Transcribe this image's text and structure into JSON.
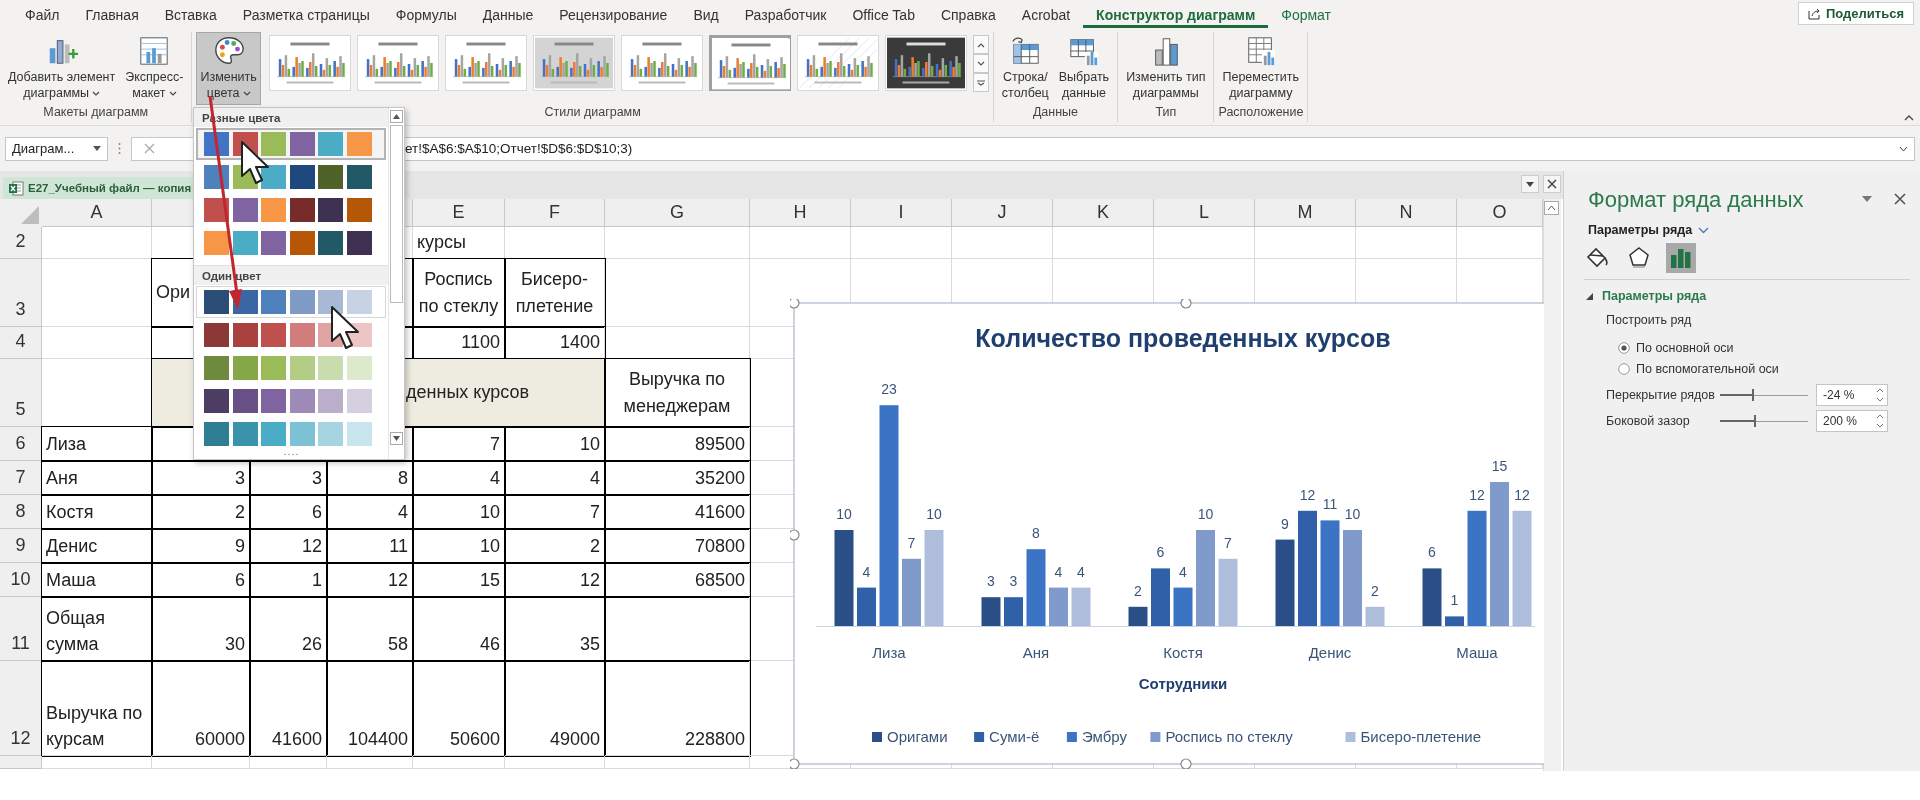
{
  "tabs": [
    {
      "label": "Файл",
      "selected": false,
      "contextual": false
    },
    {
      "label": "Главная",
      "selected": false,
      "contextual": false
    },
    {
      "label": "Вставка",
      "selected": false,
      "contextual": false
    },
    {
      "label": "Разметка страницы",
      "selected": false,
      "contextual": false
    },
    {
      "label": "Формулы",
      "selected": false,
      "contextual": false
    },
    {
      "label": "Данные",
      "selected": false,
      "contextual": false
    },
    {
      "label": "Рецензирование",
      "selected": false,
      "contextual": false
    },
    {
      "label": "Вид",
      "selected": false,
      "contextual": false
    },
    {
      "label": "Разработчик",
      "selected": false,
      "contextual": false
    },
    {
      "label": "Office Tab",
      "selected": false,
      "contextual": false
    },
    {
      "label": "Справка",
      "selected": false,
      "contextual": false
    },
    {
      "label": "Acrobat",
      "selected": false,
      "contextual": false
    },
    {
      "label": "Конструктор диаграмм",
      "selected": true,
      "contextual": true
    },
    {
      "label": "Формат",
      "selected": false,
      "contextual": true
    }
  ],
  "share_button": {
    "label": "Поделиться"
  },
  "ribbon": {
    "groups": [
      {
        "label": "Макеты диаграмм",
        "buttons": [
          {
            "kind": "add-element",
            "label": "Добавить элемент\nдиаграммы",
            "dropdown": true,
            "pressed": false
          },
          {
            "kind": "quick-layout",
            "label": "Экспресс-\nмакет",
            "dropdown": true,
            "pressed": false
          }
        ]
      },
      {
        "label": "Стили диаграмм",
        "buttons": [
          {
            "kind": "colors",
            "label": "Изменить\nцвета",
            "dropdown": true,
            "pressed": true
          }
        ],
        "styles": [
          {
            "kind": "light",
            "selected": false
          },
          {
            "kind": "light",
            "selected": false
          },
          {
            "kind": "light",
            "selected": false
          },
          {
            "kind": "gray",
            "selected": false
          },
          {
            "kind": "light",
            "selected": false
          },
          {
            "kind": "light",
            "selected": true
          },
          {
            "kind": "hatched",
            "selected": false
          },
          {
            "kind": "dark",
            "selected": false
          }
        ]
      },
      {
        "label": "Данные",
        "buttons": [
          {
            "kind": "switch",
            "label": "Строка/\nстолбец",
            "dropdown": false,
            "pressed": false
          },
          {
            "kind": "select-data",
            "label": "Выбрать\nданные",
            "dropdown": false,
            "pressed": false
          }
        ]
      },
      {
        "label": "Тип",
        "buttons": [
          {
            "kind": "chart-type",
            "label": "Изменить тип\nдиаграммы",
            "dropdown": false,
            "pressed": false
          }
        ]
      },
      {
        "label": "Расположение",
        "buttons": [
          {
            "kind": "move",
            "label": "Переместить\nдиаграмму",
            "dropdown": false,
            "pressed": false
          }
        ]
      }
    ]
  },
  "formula_bar": {
    "name_box": "Диаграм...",
    "formula": "ет!$A$6:$A$10;Отчет!$D$6:$D$10;3)"
  },
  "workbook_tab": {
    "title": "E27_Учебный файл — копия"
  },
  "color_menu": {
    "groups": [
      {
        "label": "Разные цвета",
        "options": [
          {
            "selected": true,
            "hovered": false,
            "swatches": [
              {
                "color": "#4472c4"
              },
              {
                "color": "#c0504d"
              },
              {
                "color": "#9bbb59"
              },
              {
                "color": "#8064a2"
              },
              {
                "color": "#4bacc6"
              },
              {
                "color": "#f79646"
              }
            ]
          },
          {
            "selected": false,
            "hovered": false,
            "swatches": [
              {
                "color": "#4f81bd"
              },
              {
                "color": "#9bbb59"
              },
              {
                "color": "#4bacc6"
              },
              {
                "color": "#1f497d"
              },
              {
                "color": "#4f6228"
              },
              {
                "color": "#215967"
              }
            ]
          },
          {
            "selected": false,
            "hovered": false,
            "swatches": [
              {
                "color": "#c0504d"
              },
              {
                "color": "#8064a2"
              },
              {
                "color": "#f79646"
              },
              {
                "color": "#772c2a"
              },
              {
                "color": "#3f3151"
              },
              {
                "color": "#b65708"
              }
            ]
          },
          {
            "selected": false,
            "hovered": false,
            "swatches": [
              {
                "color": "#f79646"
              },
              {
                "color": "#4bacc6"
              },
              {
                "color": "#8064a2"
              },
              {
                "color": "#b65708"
              },
              {
                "color": "#215967"
              },
              {
                "color": "#3f3151"
              }
            ]
          }
        ]
      },
      {
        "label": "Один цвет",
        "options": [
          {
            "selected": false,
            "hovered": true,
            "swatches": [
              {
                "color": "#2c4d75"
              },
              {
                "color": "#3a67a3"
              },
              {
                "color": "#4f81bd"
              },
              {
                "color": "#7f9bc6"
              },
              {
                "color": "#a7b9d7"
              },
              {
                "color": "#c7d2e5"
              }
            ]
          },
          {
            "selected": false,
            "hovered": false,
            "swatches": [
              {
                "color": "#8c3836"
              },
              {
                "color": "#a9413e"
              },
              {
                "color": "#c0504d"
              },
              {
                "color": "#d07d7b"
              },
              {
                "color": "#dea3a2"
              },
              {
                "color": "#ebc6c5"
              }
            ]
          },
          {
            "selected": false,
            "hovered": false,
            "swatches": [
              {
                "color": "#6f8a3c"
              },
              {
                "color": "#86a748"
              },
              {
                "color": "#9bbb59"
              },
              {
                "color": "#b3cc86"
              },
              {
                "color": "#c9dcab"
              },
              {
                "color": "#dde9cd"
              }
            ]
          },
          {
            "selected": false,
            "hovered": false,
            "swatches": [
              {
                "color": "#4e3d63"
              },
              {
                "color": "#684f86"
              },
              {
                "color": "#8064a2"
              },
              {
                "color": "#9d8ab6"
              },
              {
                "color": "#bbaecb"
              },
              {
                "color": "#d6cfe0"
              }
            ]
          },
          {
            "selected": false,
            "hovered": false,
            "swatches": [
              {
                "color": "#2e7f93"
              },
              {
                "color": "#3893ab"
              },
              {
                "color": "#4bacc6"
              },
              {
                "color": "#7dc2d4"
              },
              {
                "color": "#a6d5e1"
              },
              {
                "color": "#c8e5ed"
              }
            ]
          }
        ]
      }
    ]
  },
  "sheet": {
    "column_headers": [
      "A",
      "E",
      "F",
      "G",
      "H",
      "I",
      "J",
      "K",
      "L",
      "M",
      "N",
      "O"
    ],
    "rows": [
      {
        "number": "2",
        "cells": {
          "E": "курсы"
        }
      },
      {
        "number": "3",
        "cells": {
          "B": "Ори",
          "E": "Роспись по стеклу",
          "F": "Бисеро-плетение"
        }
      },
      {
        "number": "4",
        "cells": {
          "E": "1100",
          "F": "1400"
        }
      },
      {
        "number": "5",
        "cells": {
          "B": "денных курсов",
          "G": "Выручка по менеджерам"
        }
      },
      {
        "number": "6",
        "cells": {
          "A": "Лиза",
          "E": "7",
          "F": "10",
          "G": "89500"
        }
      },
      {
        "number": "7",
        "cells": {
          "A": "Аня",
          "B": "3",
          "C": "3",
          "D": "8",
          "E": "4",
          "F": "4",
          "G": "35200"
        }
      },
      {
        "number": "8",
        "cells": {
          "A": "Костя",
          "B": "2",
          "C": "6",
          "D": "4",
          "E": "10",
          "F": "7",
          "G": "41600"
        }
      },
      {
        "number": "9",
        "cells": {
          "A": "Денис",
          "B": "9",
          "C": "12",
          "D": "11",
          "E": "10",
          "F": "2",
          "G": "70800"
        }
      },
      {
        "number": "10",
        "cells": {
          "A": "Маша",
          "B": "6",
          "C": "1",
          "D": "12",
          "E": "15",
          "F": "12",
          "G": "68500"
        }
      },
      {
        "number": "11",
        "cells": {
          "A": "Общая сумма",
          "B": "30",
          "C": "26",
          "D": "58",
          "E": "46",
          "F": "35"
        }
      },
      {
        "number": "12",
        "cells": {
          "A": "Выручка по курсам",
          "B": "60000",
          "C": "41600",
          "D": "104400",
          "E": "50600",
          "F": "49000",
          "G": "228800"
        }
      }
    ]
  },
  "chart": {
    "selected": true,
    "chart_data": {
      "type": "bar",
      "title": "Количество проведенных курсов",
      "xlabel": "Сотрудники",
      "categories": [
        "Лиза",
        "Аня",
        "Костя",
        "Денис",
        "Маша"
      ],
      "data_labels": true,
      "legend": "bottom",
      "series": [
        {
          "name": "Оригами",
          "color": "#2a4f86",
          "values": [
            10,
            3,
            2,
            9,
            6
          ]
        },
        {
          "name": "Суми-ё",
          "color": "#3061a8",
          "values": [
            4,
            3,
            6,
            12,
            1
          ]
        },
        {
          "name": "Эмбру",
          "color": "#3b74c4",
          "values": [
            23,
            8,
            4,
            11,
            12
          ]
        },
        {
          "name": "Роспись по стеклу",
          "color": "#7f9acb",
          "values": [
            7,
            4,
            10,
            10,
            15
          ]
        },
        {
          "name": "Бисеро-плетение",
          "color": "#afbddc",
          "values": [
            10,
            4,
            7,
            2,
            12
          ]
        }
      ]
    }
  },
  "format_pane": {
    "title": "Формат ряда данных",
    "options_menu": "Параметры ряда",
    "icon_tabs": [
      {
        "kind": "fill",
        "selected": false
      },
      {
        "kind": "effects",
        "selected": false
      },
      {
        "kind": "series",
        "selected": true
      }
    ],
    "section": {
      "label": "Параметры ряда",
      "expanded": true
    },
    "plot_on_label": "Построить ряд",
    "radios": [
      {
        "label": "По основной оси",
        "selected": true
      },
      {
        "label": "По вспомогательной оси",
        "selected": false
      }
    ],
    "sliders": [
      {
        "label": "Перекрытие рядов",
        "level": 0.38,
        "value": "-24 %"
      },
      {
        "label": "Боковой зазор",
        "level": 0.4,
        "value": "200 %"
      }
    ]
  }
}
